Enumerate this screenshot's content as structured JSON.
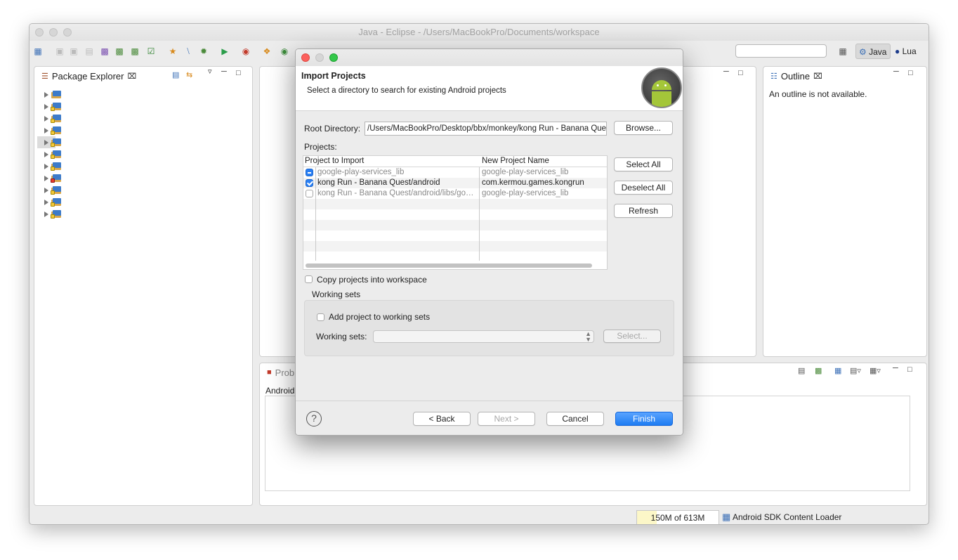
{
  "window": {
    "title": "Java - Eclipse - /Users/MacBookPro/Documents/workspace"
  },
  "perspectives": {
    "java": "Java",
    "lua": "Lua"
  },
  "package_explorer": {
    "tab_label": "Package Explorer"
  },
  "outline": {
    "tab_label": "Outline",
    "empty_message": "An outline is not available."
  },
  "bottom_panel": {
    "tab_label": "Prob",
    "sub_tab": "Android"
  },
  "status_bar": {
    "memory": "150M of 613M",
    "memory_used_fraction": 0.245,
    "loader": "Android SDK Content Loader"
  },
  "dialog": {
    "title": "Import Projects",
    "description": "Select a directory to search for existing Android projects",
    "root_label": "Root Directory:",
    "root_value": "/Users/MacBookPro/Desktop/bbx/monkey/kong Run - Banana Quest",
    "browse": "Browse...",
    "projects_label": "Projects:",
    "columns": {
      "project": "Project to Import",
      "name": "New Project Name"
    },
    "rows": [
      {
        "project": "google-play-services_lib",
        "name": "google-play-services_lib",
        "state": "mixed",
        "enabled": false
      },
      {
        "project": "kong Run - Banana Quest/android",
        "name": "com.kermou.games.kongrun",
        "state": "checked",
        "enabled": true
      },
      {
        "project": "kong Run - Banana Quest/android/libs/google-play-services_lib",
        "name": "google-play-services_lib",
        "state": "unchecked",
        "enabled": false
      }
    ],
    "select_all": "Select All",
    "deselect_all": "Deselect All",
    "refresh": "Refresh",
    "copy_label": "Copy projects into workspace",
    "working_sets_group": "Working sets",
    "add_to_ws": "Add project to working sets",
    "ws_label": "Working sets:",
    "ws_select": "Select...",
    "help": "?",
    "back": "< Back",
    "next": "Next >",
    "cancel": "Cancel",
    "finish": "Finish"
  }
}
